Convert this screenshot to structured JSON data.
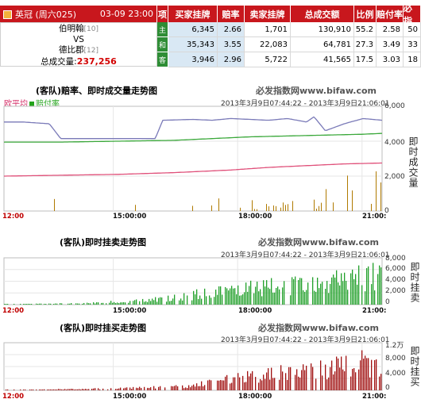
{
  "header": {
    "league": "英冠",
    "weekday": "(周六025)",
    "datetime": "03-09 23:00",
    "col_xiang": "项",
    "col_buy": "买家挂牌",
    "col_odds": "赔率",
    "col_sell": "卖家挂牌",
    "col_volume": "总成交额",
    "col_ratio": "比例",
    "col_payrate": "赔付率",
    "col_bifaw": "必指"
  },
  "match": {
    "home": "伯明翰",
    "home_rank": "[10]",
    "vs": "VS",
    "away": "德比郡",
    "away_rank": "[12]",
    "total_label": "总成交量:",
    "total_value": "237,256"
  },
  "rows": [
    {
      "tag": "主",
      "buy": "6,345",
      "odds": "2.66",
      "sell": "1,701",
      "volume": "130,910",
      "ratio": "55.2",
      "payrate": "2.58",
      "bifaw": "50"
    },
    {
      "tag": "和",
      "buy": "35,343",
      "odds": "3.55",
      "sell": "22,083",
      "volume": "64,781",
      "ratio": "27.3",
      "payrate": "3.49",
      "bifaw": "33"
    },
    {
      "tag": "客",
      "buy": "3,946",
      "odds": "2.96",
      "sell": "5,722",
      "volume": "41,565",
      "ratio": "17.5",
      "payrate": "3.03",
      "bifaw": "18"
    }
  ],
  "chart1": {
    "title": "(客队)赔率、即时成交量走势图",
    "watermark": "必发指数网www.bifaw.com",
    "legend_a": "欧平均",
    "legend_b": "赔付率",
    "timerange": "2013年3月9日07:44:22 - 2013年3月9日21:06:01",
    "x_ticks": [
      "12:00",
      "15:00:00",
      "18:00:00",
      "21:00:"
    ],
    "y_ticks": [
      "6,000",
      "4,000",
      "2,000",
      "0"
    ],
    "y_label": "即时成交量"
  },
  "chart2": {
    "title": "(客队)即时挂卖走势图",
    "watermark": "必发指数网www.bifaw.com",
    "timerange": "2013年3月9日07:44:22 - 2013年3月9日21:06:01",
    "x_ticks": [
      "12:00",
      "15:00:00",
      "18:00:00",
      "21:00:"
    ],
    "y_ticks": [
      "8,000",
      "6,000",
      "4,000",
      "2,000",
      "0"
    ],
    "y_label": "即时挂卖"
  },
  "chart3": {
    "title": "(客队)即时挂买走势图",
    "watermark": "必发指数网www.bifaw.com",
    "timerange": "2013年3月9日07:44:22 - 2013年3月9日21:06:01",
    "x_ticks": [
      "12:00",
      "15:00:00",
      "18:00:00",
      "21:00:"
    ],
    "y_ticks": [
      "1.2万",
      "8,000",
      "4,000",
      "0"
    ],
    "y_label": "即时挂买"
  },
  "chart_data": [
    {
      "type": "line",
      "title": "(客队)赔率、即时成交量走势图",
      "x_range": [
        "12:00",
        "21:06"
      ],
      "ylim": [
        0,
        6000
      ],
      "series": [
        {
          "name": "欧平均",
          "color": "#e0507a",
          "x": [
            0,
            0.15,
            0.3,
            0.45,
            0.55,
            0.6,
            0.7,
            0.8,
            0.9,
            1.0
          ],
          "values": [
            2000,
            2050,
            2100,
            2200,
            2300,
            2350,
            2500,
            2600,
            2700,
            2750
          ]
        },
        {
          "name": "赔付率",
          "color": "#3aa83a",
          "x": [
            0,
            0.15,
            0.3,
            0.45,
            0.55,
            0.65,
            0.75,
            0.85,
            0.95,
            1.0
          ],
          "values": [
            3950,
            3950,
            4000,
            4050,
            4150,
            4250,
            4300,
            4350,
            4400,
            4450
          ]
        },
        {
          "color": "#7a7ab8",
          "x": [
            0,
            0.05,
            0.12,
            0.15,
            0.2,
            0.3,
            0.4,
            0.42,
            0.5,
            0.55,
            0.6,
            0.65,
            0.7,
            0.75,
            0.8,
            0.82,
            0.85,
            0.9,
            0.95,
            1.0
          ],
          "values": [
            5100,
            5100,
            5000,
            4150,
            4150,
            4150,
            4150,
            5200,
            5250,
            5200,
            5300,
            5250,
            5200,
            5300,
            5100,
            5400,
            4600,
            5000,
            5300,
            5200
          ]
        }
      ]
    },
    {
      "type": "bar",
      "title": "(客队)即时挂卖走势图",
      "x_range": [
        "12:00",
        "21:06"
      ],
      "ylim": [
        0,
        8000
      ],
      "color": "#21a02a",
      "trend": [
        0,
        50,
        100,
        150,
        200,
        250,
        300,
        350,
        400,
        500,
        600,
        700,
        900,
        1100,
        1300,
        1500,
        1800,
        2000,
        2200,
        2400,
        2600,
        2800,
        3000,
        3200,
        3300,
        3500,
        3700,
        3900,
        4000,
        4200,
        4500,
        4800,
        5000,
        5300,
        5700,
        6000
      ]
    },
    {
      "type": "bar",
      "title": "(客队)即时挂买走势图",
      "x_range": [
        "12:00",
        "21:06"
      ],
      "ylim": [
        0,
        12000
      ],
      "color": "#a01010",
      "trend": [
        0,
        100,
        150,
        200,
        250,
        300,
        350,
        400,
        500,
        600,
        700,
        800,
        900,
        1000,
        1100,
        1300,
        1500,
        1700,
        2000,
        2300,
        2600,
        3000,
        3400,
        3800,
        4200,
        4600,
        5000,
        5400,
        5800,
        6200,
        6600,
        7000,
        7400,
        7800,
        8000,
        8200
      ]
    }
  ],
  "colors": {
    "header_bg": "#c8171d",
    "tag_bg": "#2e8d35",
    "buy_bg": "#d9e8f4",
    "vol_bar": "#b07a00",
    "sell_bar": "#21a02a",
    "buy_bar": "#a01010"
  }
}
